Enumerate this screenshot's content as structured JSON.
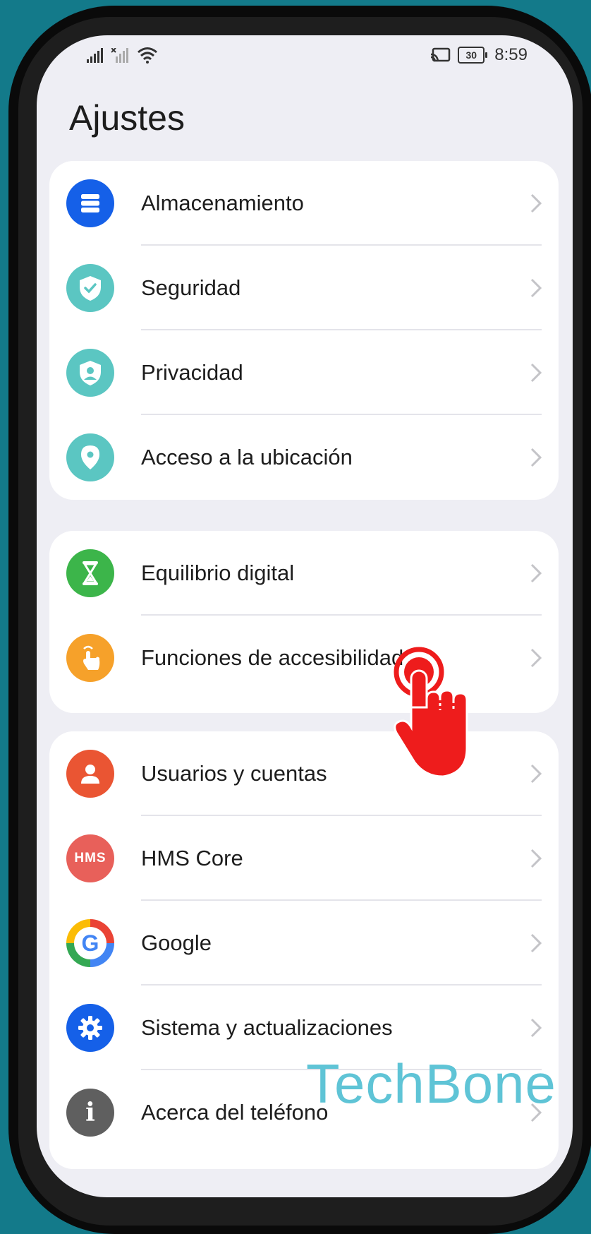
{
  "status_bar": {
    "battery": "30",
    "time": "8:59"
  },
  "page_title": "Ajustes",
  "groups": [
    {
      "items": [
        {
          "label": "Almacenamiento",
          "icon": "storage-icon",
          "color": "#1560e8"
        },
        {
          "label": "Seguridad",
          "icon": "shield-check-icon",
          "color": "#5bc6c2"
        },
        {
          "label": "Privacidad",
          "icon": "privacy-shield-icon",
          "color": "#5bc6c2"
        },
        {
          "label": "Acceso a la ubicación",
          "icon": "location-pin-icon",
          "color": "#5bc6c2"
        }
      ]
    },
    {
      "items": [
        {
          "label": "Equilibrio digital",
          "icon": "hourglass-icon",
          "color": "#3cb54a"
        },
        {
          "label": "Funciones de accesibilidad",
          "icon": "hand-touch-icon",
          "color": "#f6a12a"
        }
      ]
    },
    {
      "items": [
        {
          "label": "Usuarios y cuentas",
          "icon": "user-icon",
          "color": "#ea5533"
        },
        {
          "label": "HMS Core",
          "icon": "hms-logo-icon",
          "color": "#e8605a",
          "icon_text": "HMS"
        },
        {
          "label": "Google",
          "icon": "google-logo-icon",
          "color": "#4285f4",
          "icon_text": "G"
        },
        {
          "label": "Sistema y actualizaciones",
          "icon": "gear-icon",
          "color": "#1560e8"
        },
        {
          "label": "Acerca del teléfono",
          "icon": "info-icon",
          "color": "#5f5f5f",
          "icon_text": "i"
        }
      ]
    }
  ],
  "watermark": "TechBone",
  "tap_indicator_color": "#ee1c1c"
}
